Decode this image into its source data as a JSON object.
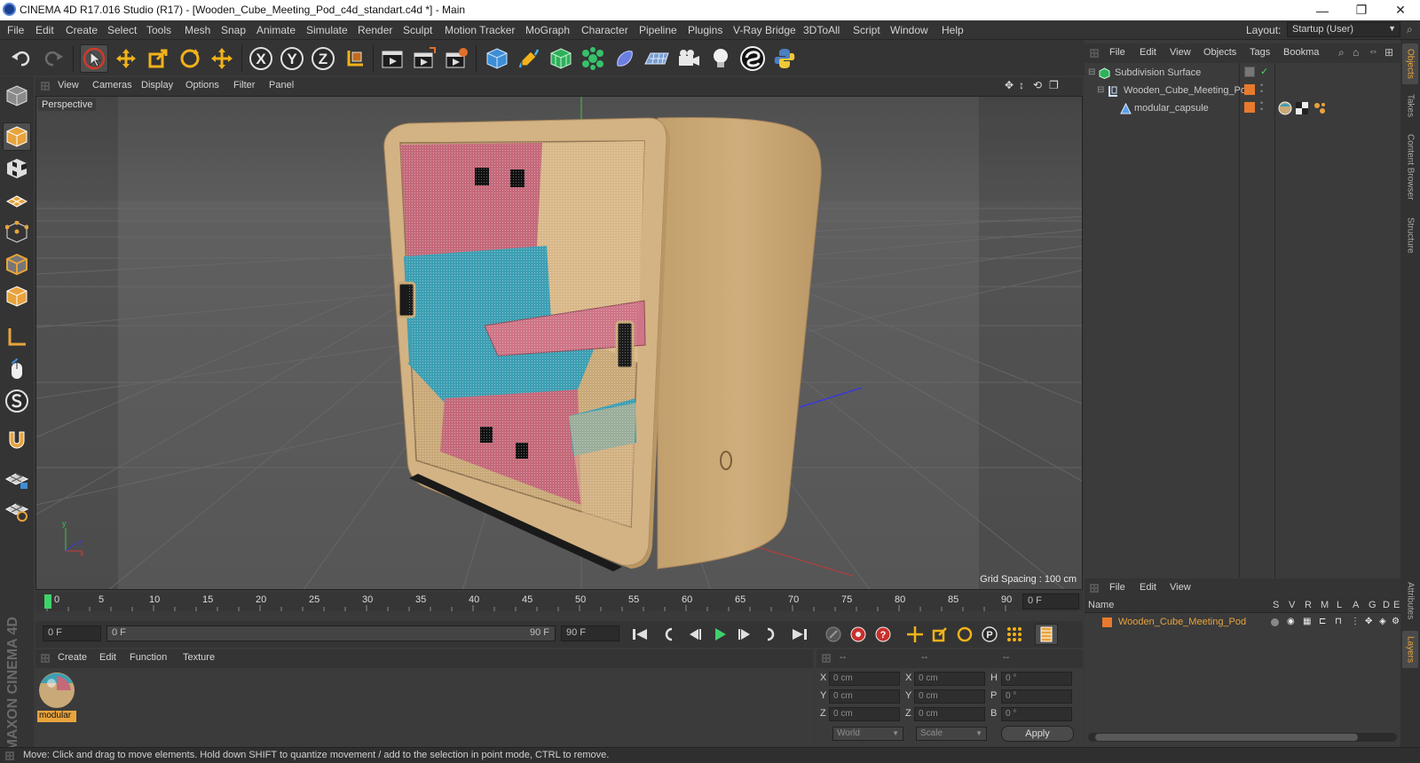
{
  "window": {
    "title": "CINEMA 4D R17.016 Studio (R17) - [Wooden_Cube_Meeting_Pod_c4d_standart.c4d *] - Main",
    "controls": {
      "minimize": "—",
      "restore": "❐",
      "close": "✕"
    }
  },
  "menu": [
    "File",
    "Edit",
    "Create",
    "Select",
    "Tools",
    "Mesh",
    "Snap",
    "Animate",
    "Simulate",
    "Render",
    "Sculpt",
    "Motion Tracker",
    "MoGraph",
    "Character",
    "Pipeline",
    "Plugins",
    "V-Ray Bridge",
    "3DToAll",
    "Script",
    "Window",
    "Help"
  ],
  "layout": {
    "label": "Layout:",
    "value": "Startup (User)"
  },
  "toolbar": {
    "axis_x": "X",
    "axis_y": "Y",
    "axis_z": "Z",
    "icons": [
      "undo-icon",
      "redo-icon",
      "live-selection-icon",
      "move-icon",
      "scale-icon",
      "rotate-icon",
      "recent-tools-icon",
      "axis-x-icon",
      "axis-y-icon",
      "axis-z-icon",
      "world-coordinates-icon",
      "render-view-icon",
      "render-picture-viewer-icon",
      "edit-render-settings-icon",
      "cube-icon",
      "pen-spline-icon",
      "subdivision-surface-icon",
      "cloner-icon",
      "deformer-icon",
      "floor-icon",
      "camera-icon",
      "light-icon",
      "script-icon",
      "python-icon"
    ]
  },
  "viewport": {
    "menu": [
      "View",
      "Cameras",
      "Display",
      "Options",
      "Filter",
      "Panel"
    ],
    "label": "Perspective",
    "grid_spacing": "Grid Spacing : 100 cm",
    "colors": {
      "bg": "#5b5b5b",
      "wood": "#c9a978",
      "pink": "#c4697a",
      "teal": "#3d9fb3"
    }
  },
  "timeline": {
    "ticks": [
      "0",
      "5",
      "10",
      "15",
      "20",
      "25",
      "30",
      "35",
      "40",
      "45",
      "50",
      "55",
      "60",
      "65",
      "70",
      "75",
      "80",
      "85",
      "90"
    ],
    "current_frame": "0 F",
    "start_frame": "0 F",
    "range_start": "0 F",
    "range_end": "90 F",
    "end_frame": "90 F"
  },
  "material_manager": {
    "menu": [
      "Create",
      "Edit",
      "Function",
      "Texture"
    ],
    "materials": [
      {
        "name": "modular"
      }
    ]
  },
  "coordinates": {
    "header": [
      "--",
      "--",
      "--"
    ],
    "rows": [
      {
        "label": "X",
        "pos": "0 cm",
        "label2": "X",
        "size": "0 cm",
        "label3": "H",
        "rot": "0 °"
      },
      {
        "label": "Y",
        "pos": "0 cm",
        "label2": "Y",
        "size": "0 cm",
        "label3": "P",
        "rot": "0 °"
      },
      {
        "label": "Z",
        "pos": "0 cm",
        "label2": "Z",
        "size": "0 cm",
        "label3": "B",
        "rot": "0 °"
      }
    ],
    "mode": "World",
    "transform": "Scale",
    "apply_label": "Apply"
  },
  "status": "Move: Click and drag to move elements. Hold down SHIFT to quantize movement / add to the selection in point mode, CTRL to remove.",
  "object_manager": {
    "menu": [
      "File",
      "Edit",
      "View",
      "Objects",
      "Tags",
      "Bookma"
    ],
    "objects": [
      {
        "name": "Subdivision Surface",
        "depth": 0,
        "color": "#c9c9c9"
      },
      {
        "name": "Wooden_Cube_Meeting_Pod",
        "depth": 1,
        "color": "#c9c9c9"
      },
      {
        "name": "modular_capsule",
        "depth": 2,
        "color": "#c9c9c9"
      }
    ]
  },
  "layer_manager": {
    "menu": [
      "File",
      "Edit",
      "View"
    ],
    "columns": {
      "name": "Name",
      "flags": [
        "S",
        "V",
        "R",
        "M",
        "L",
        "A",
        "G",
        "D",
        "E"
      ]
    },
    "layers": [
      {
        "name": "Wooden_Cube_Meeting_Pod",
        "color": "#e87a2d"
      }
    ]
  },
  "right_tabs": [
    "Objects",
    "Takes",
    "Content Browser",
    "Structure",
    "Attributes",
    "Layers"
  ],
  "brand": "MAXON CINEMA 4D"
}
